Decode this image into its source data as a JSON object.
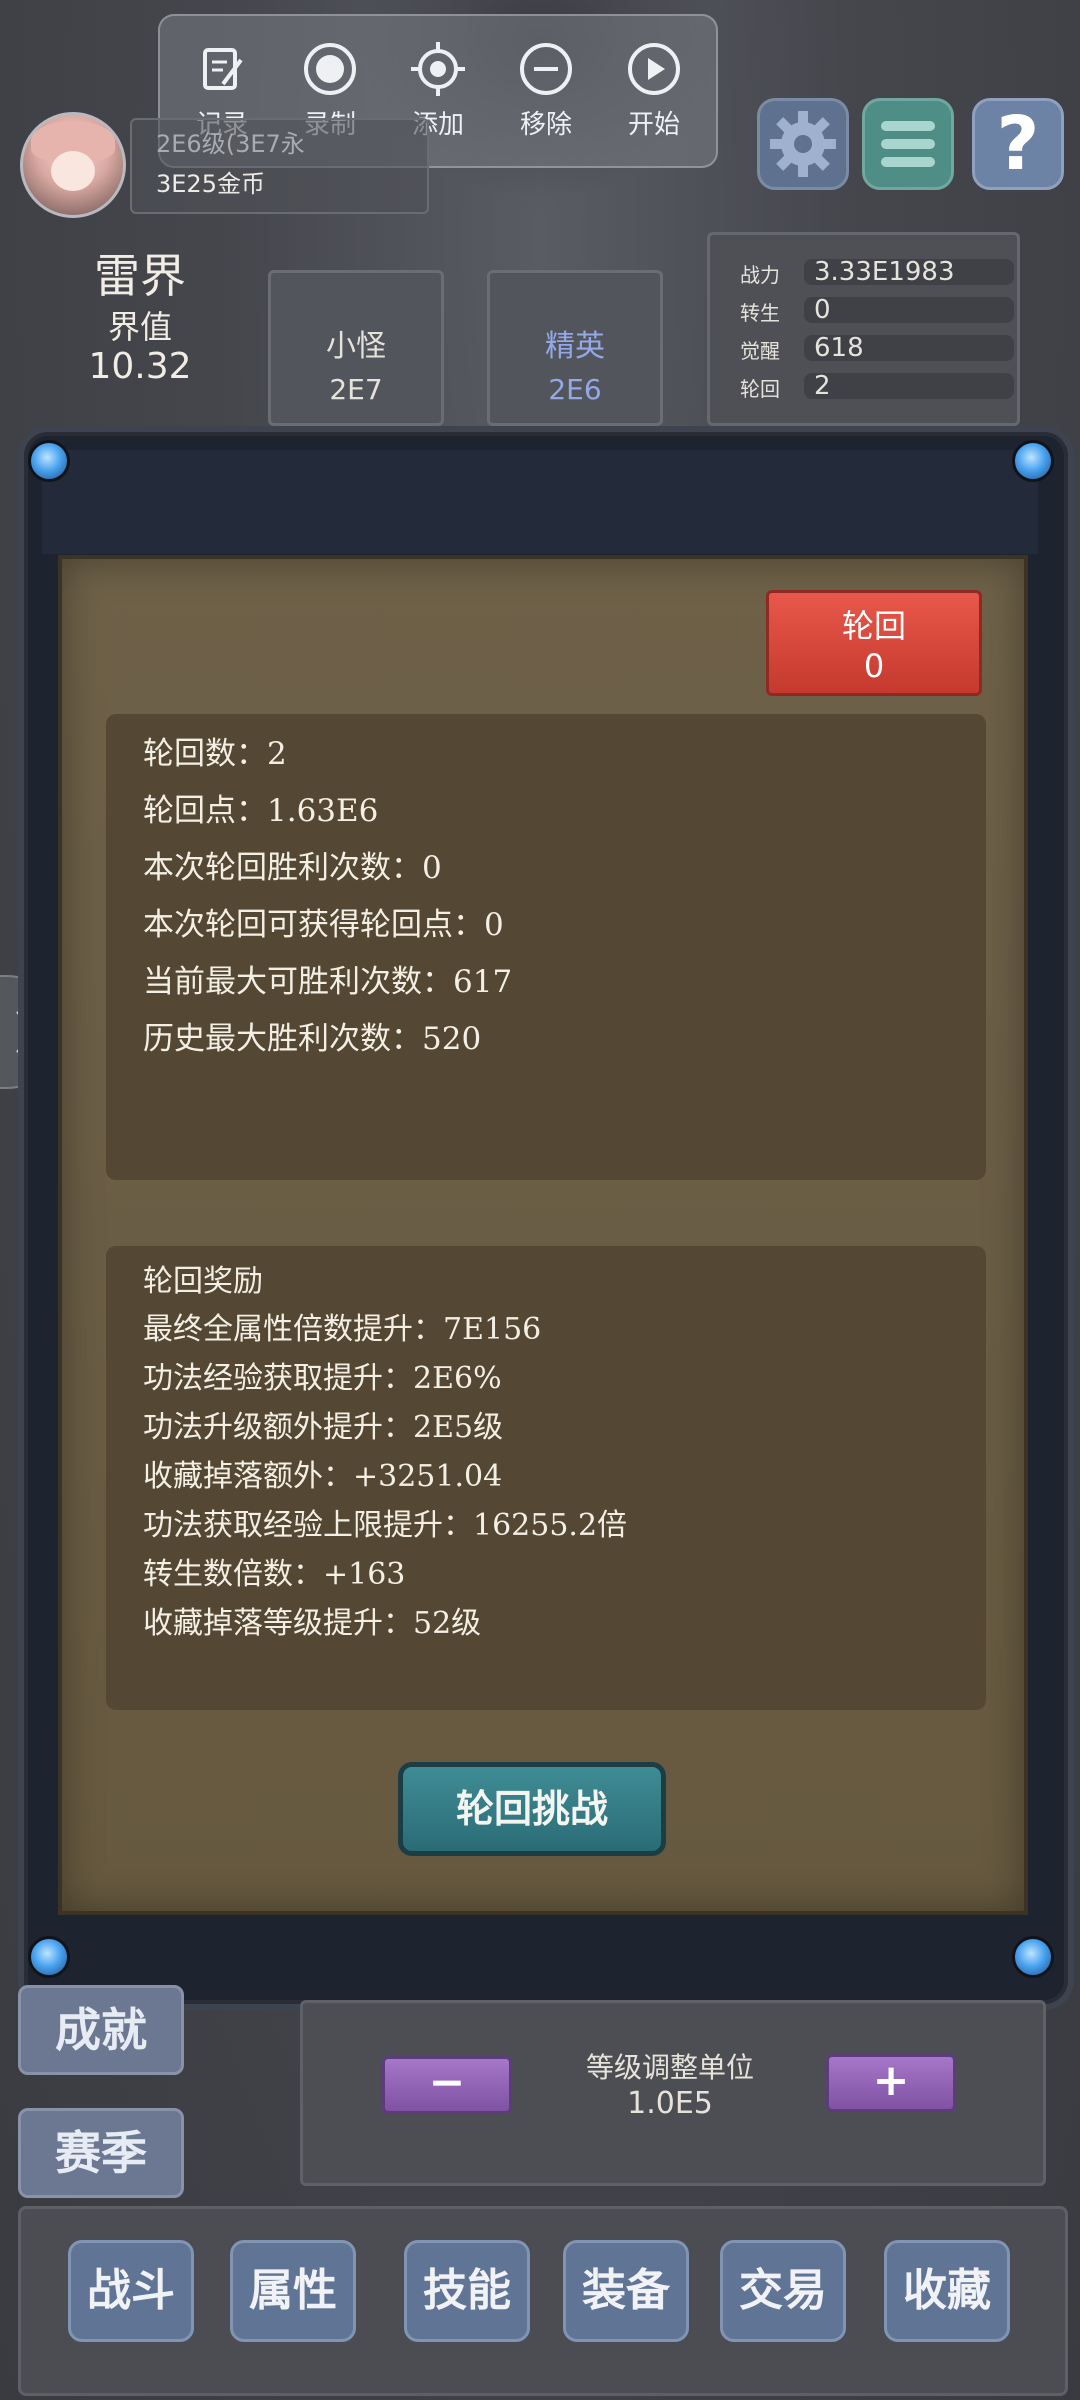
{
  "toolbar": {
    "items": [
      {
        "label": "记录",
        "icon": "edit-icon"
      },
      {
        "label": "录制",
        "icon": "record-icon"
      },
      {
        "label": "添加",
        "icon": "crosshair-icon"
      },
      {
        "label": "移除",
        "icon": "minus-circle-icon"
      },
      {
        "label": "开始",
        "icon": "play-icon"
      }
    ]
  },
  "player": {
    "level_text": "2E6级(3E7永",
    "gold_text": "3E25金币"
  },
  "world": {
    "name": "雷界",
    "value_label": "界值",
    "value": "10.32"
  },
  "enemies": {
    "minion": {
      "label": "小怪",
      "value": "2E7"
    },
    "elite": {
      "label": "精英",
      "value": "2E6"
    }
  },
  "stats": [
    {
      "key": "战力",
      "value": "3.33E1983"
    },
    {
      "key": "转生",
      "value": "0"
    },
    {
      "key": "觉醒",
      "value": "618"
    },
    {
      "key": "轮回",
      "value": "2"
    }
  ],
  "reincarnation": {
    "button_label": "轮回",
    "button_value": "0",
    "info_lines": [
      "轮回数：2",
      "轮回点：1.63E6",
      "本次轮回胜利次数：0",
      "本次轮回可获得轮回点：0",
      "当前最大可胜利次数：617",
      "历史最大胜利次数：520"
    ],
    "reward_title": "轮回奖励",
    "reward_lines": [
      "最终全属性倍数提升：7E156",
      "功法经验获取提升：2E6%",
      "功法升级额外提升：2E5级",
      "收藏掉落额外：+3251.04",
      "功法获取经验上限提升：16255.2倍",
      "转生数倍数：+163",
      "收藏掉落等级提升：52级"
    ],
    "challenge_label": "轮回挑战"
  },
  "side": {
    "achievement": "成就",
    "season": "赛季"
  },
  "level_adjust": {
    "title": "等级调整单位",
    "value": "1.0E5",
    "minus": "−",
    "plus": "+"
  },
  "nav": [
    "战斗",
    "属性",
    "技能",
    "装备",
    "交易",
    "收藏"
  ],
  "colors": {
    "accent_red": "#d9473a",
    "teal_button": "#2f7680",
    "parchment": "#6b5e46",
    "panel_brown": "#544733"
  }
}
